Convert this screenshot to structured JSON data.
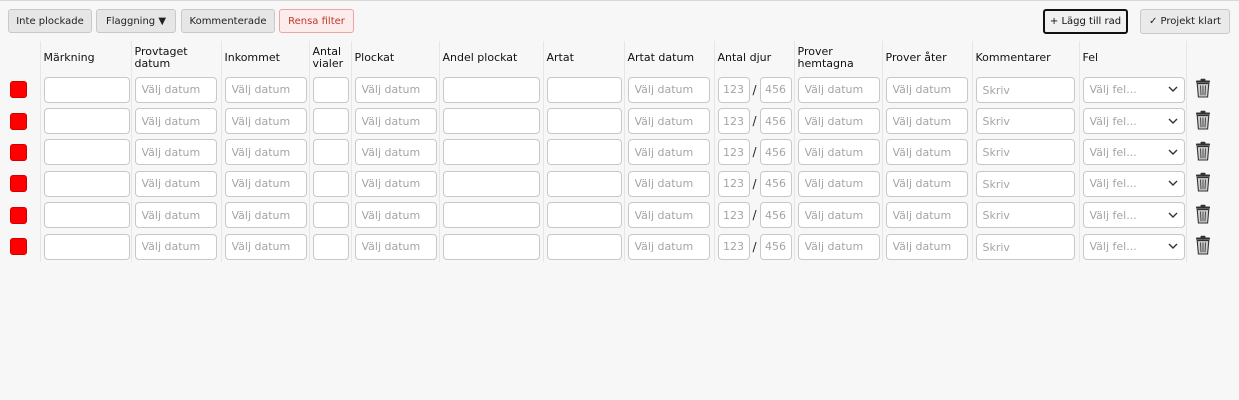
{
  "toolbar": {
    "inte_plockade": "Inte plockade",
    "flaggning": "Flaggning ▼",
    "kommenterade": "Kommenterade",
    "rensa_filter": "Rensa filter",
    "lagg_till_rad": "+ Lägg till rad",
    "projekt_klart": "✓ Projekt klart"
  },
  "columns": {
    "markning": "Märkning",
    "provtaget_datum": "Provtaget datum",
    "inkommet": "Inkommet",
    "antal_vialer": "Antal vialer",
    "plockat": "Plockat",
    "andel_plockat": "Andel plockat",
    "artat": "Artat",
    "artat_datum": "Artat datum",
    "antal_djur": "Antal djur",
    "prover_hemtagna": "Prover hemtagna",
    "prover_ater": "Prover åter",
    "kommentarer": "Kommentarer",
    "fel": "Fel"
  },
  "placeholders": {
    "date": "Välj datum",
    "djur_a": "123",
    "djur_b": "456",
    "comment": "Skriv",
    "fel": "Välj fel..."
  },
  "row_count": 6,
  "colors": {
    "flag": "#ff0000",
    "danger_text": "#c0392b"
  },
  "icons": {
    "trash": "trash-icon",
    "dropdown": "chevron-down-icon",
    "flag": "flag-square"
  }
}
